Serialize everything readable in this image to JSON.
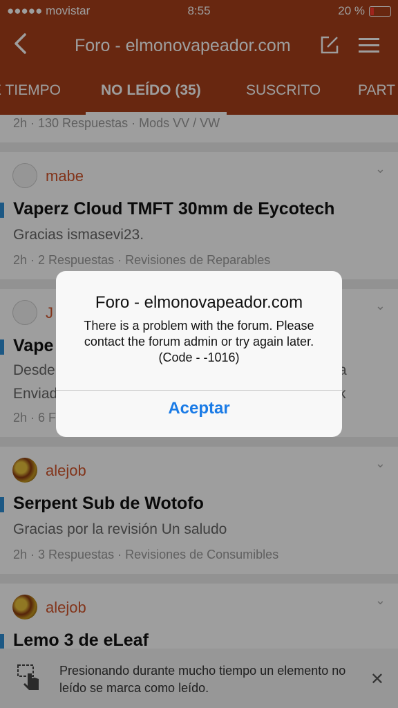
{
  "status": {
    "carrier": "●●●●● movistar",
    "time": "8:55",
    "battery": "20 %"
  },
  "nav": {
    "title": "Foro - elmonovapeador.com",
    "back_icon": "back-chevron-icon",
    "compose_icon": "compose-icon",
    "menu_icon": "hamburger-menu-icon"
  },
  "tabs": [
    {
      "label": "E TIEMPO"
    },
    {
      "label": "NO LEÍDO (35)"
    },
    {
      "label": "SUSCRITO"
    },
    {
      "label": "PART"
    }
  ],
  "partial_meta": "2h · 130 Respuestas · Mods VV / VW",
  "posts": [
    {
      "author": "mabe",
      "title": "Vaperz Cloud TMFT 30mm de Eycotech",
      "excerpt": "Gracias ismasevi23.",
      "meta": "2h · 2 Respuestas · Revisiones de Reparables"
    },
    {
      "author": "J",
      "title": "Vape",
      "excerpt1": "Desde",
      "excerpt1_tail": "a",
      "excerpt2": "Enviad",
      "excerpt2_tail": "k",
      "meta": "2h · 6 F"
    },
    {
      "author": "alejob",
      "title": "Serpent Sub de Wotofo",
      "excerpt": "Gracias por la revisión Un saludo",
      "meta": "2h · 3 Respuestas · Revisiones de Consumibles"
    },
    {
      "author": "alejob",
      "title": "Lemo 3 de eLeaf"
    }
  ],
  "alert": {
    "title": "Foro - elmonovapeador.com",
    "message": "There is a problem with the forum. Please contact the forum admin or try again later. (Code - -1016)",
    "button": "Aceptar"
  },
  "tip": {
    "text": "Presionando durante mucho tiempo un elemento no leído se marca como leído.",
    "close": "✕"
  },
  "colors": {
    "header": "#a8401b",
    "author": "#d2542b",
    "accent": "#1a7be6",
    "unread": "#2e8fd6"
  }
}
